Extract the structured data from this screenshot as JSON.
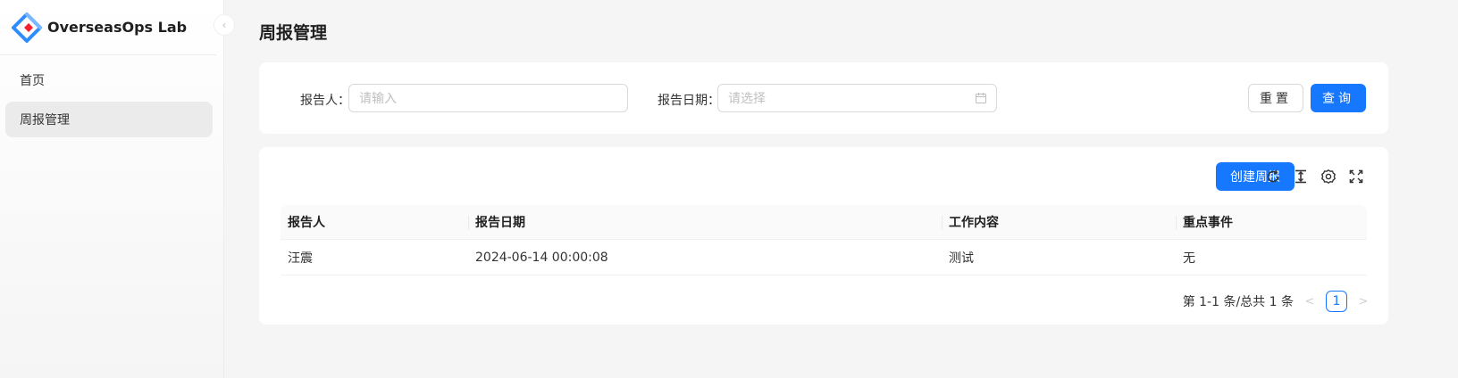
{
  "app": {
    "title": "OverseasOps Lab"
  },
  "sidebar": {
    "items": [
      {
        "label": "首页"
      },
      {
        "label": "周报管理"
      }
    ]
  },
  "page": {
    "title": "周报管理"
  },
  "search": {
    "reporter_label": "报告人",
    "reporter_placeholder": "请输入",
    "date_label": "报告日期",
    "date_placeholder": "请选择",
    "reset_label": "重置",
    "query_label": "查询"
  },
  "toolbar": {
    "create_label": "创建周报",
    "icons": [
      "reload-icon",
      "column-height-icon",
      "setting-icon",
      "fullscreen-icon"
    ]
  },
  "table": {
    "columns": [
      "报告人",
      "报告日期",
      "工作内容",
      "重点事件"
    ],
    "rows": [
      [
        "汪震",
        "2024-06-14 00:00:08",
        "测试",
        "无"
      ]
    ]
  },
  "pagination": {
    "summary": "第 1-1 条/总共 1 条",
    "current_page": "1"
  },
  "colors": {
    "primary": "#1677ff",
    "logo_blue": "#2f8cff",
    "logo_red": "#f5222d"
  }
}
